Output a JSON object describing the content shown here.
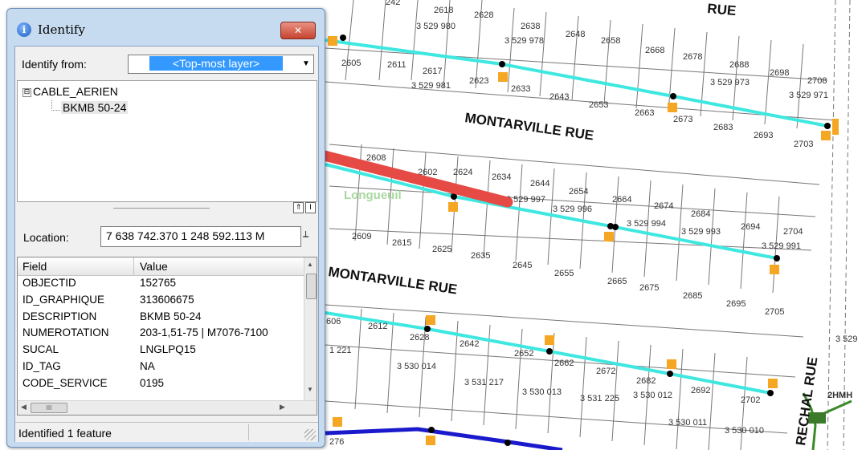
{
  "window": {
    "title": "Identify",
    "title_icon": "info-icon",
    "close_label": "✕",
    "identify_from_label": "Identify from:",
    "layer_selected": "<Top-most layer>",
    "tree": {
      "expander": "⊟",
      "layer": "CABLE_AERIEN",
      "feature": "BKMB 50-24"
    },
    "splitter_buttons": [
      "⇑",
      "I"
    ],
    "location_label": "Location:",
    "location_value": "7 638 742.370  1 248 592.113 M",
    "location_button": "⟂",
    "grid": {
      "headers": {
        "field": "Field",
        "value": "Value"
      },
      "rows": [
        {
          "field": "OBJECTID",
          "value": "152765"
        },
        {
          "field": "ID_GRAPHIQUE",
          "value": "313606675"
        },
        {
          "field": "DESCRIPTION",
          "value": "BKMB 50-24"
        },
        {
          "field": "NUMEROTATION",
          "value": "203-1,51-75 | M7076-7100"
        },
        {
          "field": "SUCAL",
          "value": "LNGLPQ15"
        },
        {
          "field": "ID_TAG",
          "value": "NA"
        },
        {
          "field": "CODE_SERVICE",
          "value": "0195"
        }
      ],
      "hscroll_thumb": "III"
    },
    "status": "Identified 1 feature"
  },
  "map": {
    "colors": {
      "cable": "#3ee8e0",
      "fiber": "#1a1acc",
      "box": "#f5a623",
      "parcel": "#777777",
      "arrow": "#e64a45"
    },
    "streets": [
      "MONTARVILLE RUE",
      "MONTARVILLE RUE",
      "RUE",
      "RECHAL RUE"
    ],
    "place": "Longueuil",
    "lots": [
      "3 529 980",
      "3 529 978",
      "3 529 981",
      "3 529 973",
      "3 529 971",
      "3 529 997",
      "3 529 996",
      "3 529 994",
      "3 529 993",
      "3 529 991",
      "3 530 014",
      "3 531 217",
      "3 530 013",
      "3 531 225",
      "3 530 012",
      "3 530 011",
      "3 530 010",
      "3 529",
      "1 221"
    ],
    "civic_top": [
      "2618",
      "2628",
      "2638",
      "2648",
      "2658",
      "2668",
      "2678",
      "2688",
      "2698",
      "2708",
      "2605",
      "2611",
      "2617",
      "2623",
      "2633",
      "2643",
      "2653",
      "2663",
      "2673",
      "2683",
      "2693",
      "2703",
      "242"
    ],
    "civic_mid": [
      "2608",
      "2602",
      "2624",
      "2634",
      "2644",
      "2654",
      "2664",
      "2674",
      "2684",
      "2694",
      "2704",
      "2609",
      "2615",
      "2625",
      "2635",
      "2645",
      "2655",
      "2665",
      "2675",
      "2685",
      "2695",
      "2705"
    ],
    "civic_bot": [
      "2612",
      "2628",
      "2642",
      "2652",
      "2662",
      "2672",
      "2682",
      "2692",
      "2702",
      "606",
      "276",
      "2HMH"
    ]
  }
}
